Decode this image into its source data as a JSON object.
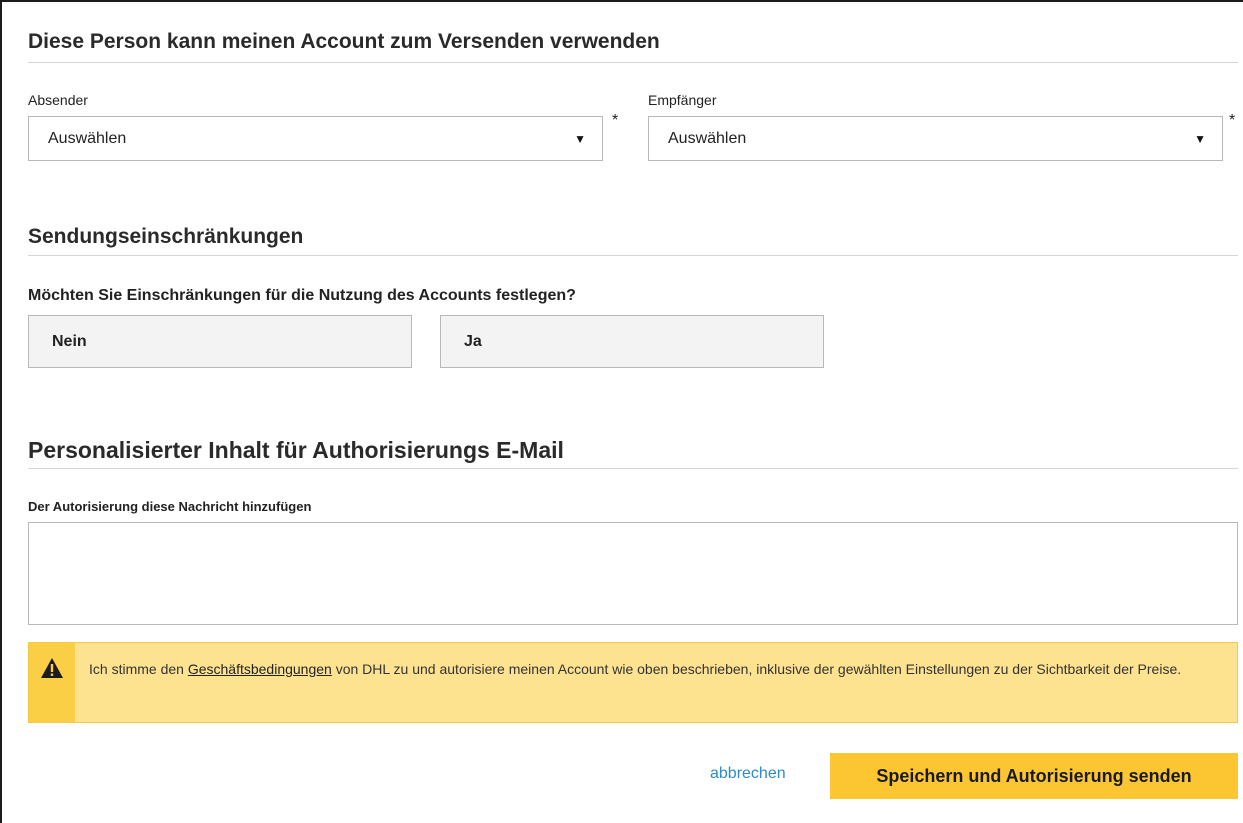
{
  "account_usage": {
    "title": "Diese Person kann meinen Account zum Versenden verwenden",
    "sender": {
      "label": "Absender",
      "value": "Auswählen",
      "required": "*"
    },
    "recipient": {
      "label": "Empfänger",
      "value": "Auswählen",
      "required": "*"
    }
  },
  "restrictions": {
    "title": "Sendungseinschränkungen",
    "question": "Möchten Sie Einschränkungen für die Nutzung des Accounts festlegen?",
    "options": [
      "Nein",
      "Ja"
    ]
  },
  "email_content": {
    "title": "Personalisierter Inhalt für Authorisierungs E-Mail",
    "message_label": "Der Autorisierung diese Nachricht hinzufügen",
    "message_value": ""
  },
  "terms_notice": {
    "text_before": "Ich stimme den ",
    "link": "Geschäftsbedingungen",
    "text_after": " von DHL zu und autorisiere meinen Account wie oben beschrieben, inklusive der gewählten Einstellungen zu der Sichtbarkeit der Preise.",
    "icon": "warning-icon"
  },
  "actions": {
    "cancel_label": "abbrechen",
    "submit_label": "Speichern und Autorisierung senden"
  },
  "colors": {
    "accent_yellow": "#fcc633",
    "notice_background": "#fde290",
    "link_blue": "#2f8cc5"
  }
}
